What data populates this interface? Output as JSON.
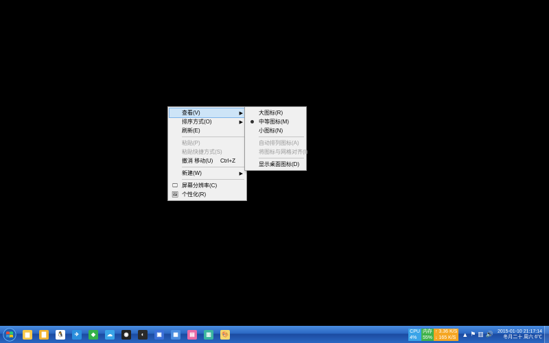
{
  "context_menu": {
    "view": "查看(V)",
    "sort": "排序方式(O)",
    "refresh": "刷新(E)",
    "paste": "粘贴(P)",
    "paste_shortcut": "粘贴快捷方式(S)",
    "undo": "撤消 移动(U)",
    "undo_key": "Ctrl+Z",
    "new": "新建(W)",
    "screenres": "屏幕分辨率(C)",
    "personalize": "个性化(R)"
  },
  "view_submenu": {
    "large": "大图标(R)",
    "medium": "中等图标(M)",
    "small": "小图标(N)",
    "auto_arrange": "自动排列图标(A)",
    "align": "将图标与网格对齐(I)",
    "show": "显示桌面图标(D)"
  },
  "gadget": {
    "cpu_label": "CPU",
    "cpu_val": "4%",
    "mem_label": "内存",
    "mem_val": "55%",
    "net_up": "3.36 K/S",
    "net_down": "165 K/S"
  },
  "clock": {
    "line1": "2015-01-10  21:17:14",
    "line2": "冬月二十 周六 6℃"
  },
  "tray_expand": "▲",
  "taskbar_items": [
    {
      "name": "explorer",
      "bg": "#f7c84a",
      "glyph": "▆"
    },
    {
      "name": "folder",
      "bg": "#f2b430",
      "glyph": "▇"
    },
    {
      "name": "qq",
      "bg": "#ffffff",
      "glyph": "🐧"
    },
    {
      "name": "app-blue",
      "bg": "#2a8fdd",
      "glyph": "✈"
    },
    {
      "name": "app-green",
      "bg": "#34b24a",
      "glyph": "◆"
    },
    {
      "name": "cloud",
      "bg": "#3aa4e8",
      "glyph": "☁"
    },
    {
      "name": "eye",
      "bg": "#222",
      "glyph": "◉"
    },
    {
      "name": "browser",
      "bg": "#2a2a2a",
      "glyph": "◐"
    },
    {
      "name": "cube",
      "bg": "#3a6fd8",
      "glyph": "▣"
    },
    {
      "name": "grid",
      "bg": "#4a8de0",
      "glyph": "▦"
    },
    {
      "name": "app-pink",
      "bg": "#e86aa6",
      "glyph": "▤"
    },
    {
      "name": "app-teal",
      "bg": "#3ab5a0",
      "glyph": "▥"
    },
    {
      "name": "paint",
      "bg": "#f5d76e",
      "glyph": "🎨"
    }
  ]
}
